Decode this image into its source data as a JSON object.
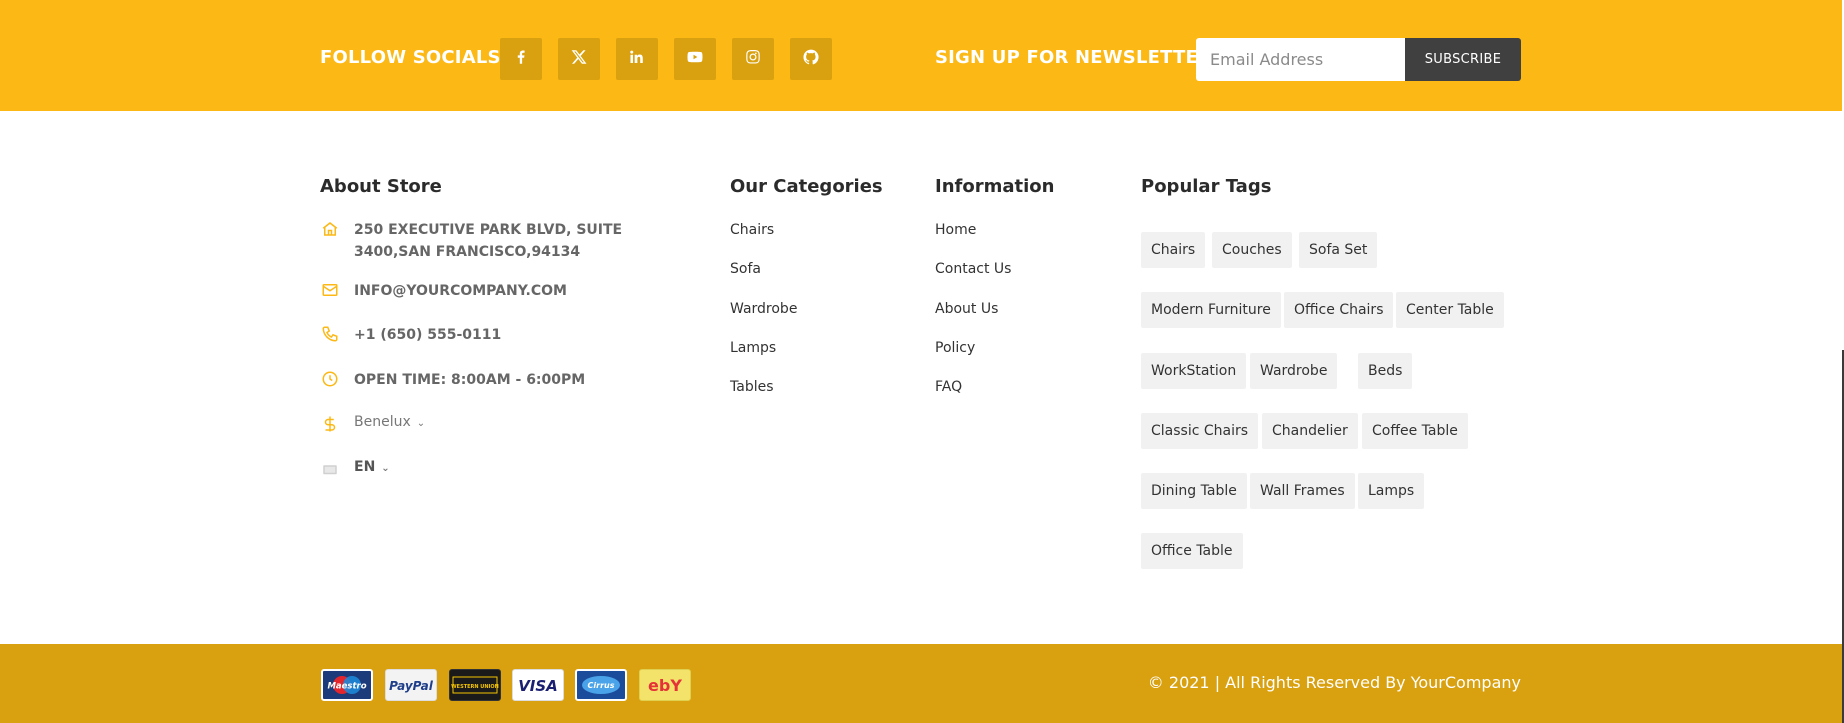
{
  "topbar": {
    "follow_title": "FOLLOW SOCIALS",
    "socials": [
      "facebook-icon",
      "x-twitter-icon",
      "linkedin-icon",
      "youtube-icon",
      "instagram-icon",
      "github-icon"
    ],
    "newsletter_title": "SIGN UP FOR NEWSLETTER",
    "email_placeholder": "Email Address",
    "subscribe_label": "SUBSCRIBE",
    "colors": {
      "background": "#fcb814",
      "social_bg": "#d9a00f",
      "button_bg": "#404040"
    }
  },
  "about": {
    "title": "About Store",
    "address": "250 EXECUTIVE PARK BLVD, SUITE 3400,SAN FRANCISCO,94134",
    "email": "INFO@YOURCOMPANY.COM",
    "phone": "+1 (650) 555-0111",
    "hours": "OPEN TIME: 8:00AM - 6:00PM",
    "currency": "Benelux",
    "language": "EN",
    "icons": [
      "home-icon",
      "mail-icon",
      "phone-icon",
      "clock-icon",
      "dollar-icon",
      "flag-icon"
    ]
  },
  "categories": {
    "title": "Our Categories",
    "items": [
      "Chairs",
      "Sofa",
      "Wardrobe",
      "Lamps",
      "Tables"
    ]
  },
  "information": {
    "title": "Information",
    "items": [
      "Home",
      "Contact Us",
      "About Us",
      "Policy",
      "FAQ"
    ]
  },
  "tags": {
    "title": "Popular Tags",
    "items": [
      "Chairs",
      "Couches",
      "Sofa Set",
      "Modern Furniture",
      "Office Chairs",
      "Center Table",
      "WorkStation",
      "Wardrobe",
      "Beds",
      "Classic Chairs",
      "Chandelier",
      "Coffee Table",
      "Dining Table",
      "Wall Frames",
      "Lamps",
      "Office Table"
    ]
  },
  "bottombar": {
    "payments": [
      "Maestro",
      "PayPal",
      "WESTERN UNION",
      "VISA",
      "Cirrus",
      "ebY"
    ],
    "copyright": "© 2021 | All Rights Reserved By YourCompany",
    "background": "#d9a00f"
  }
}
